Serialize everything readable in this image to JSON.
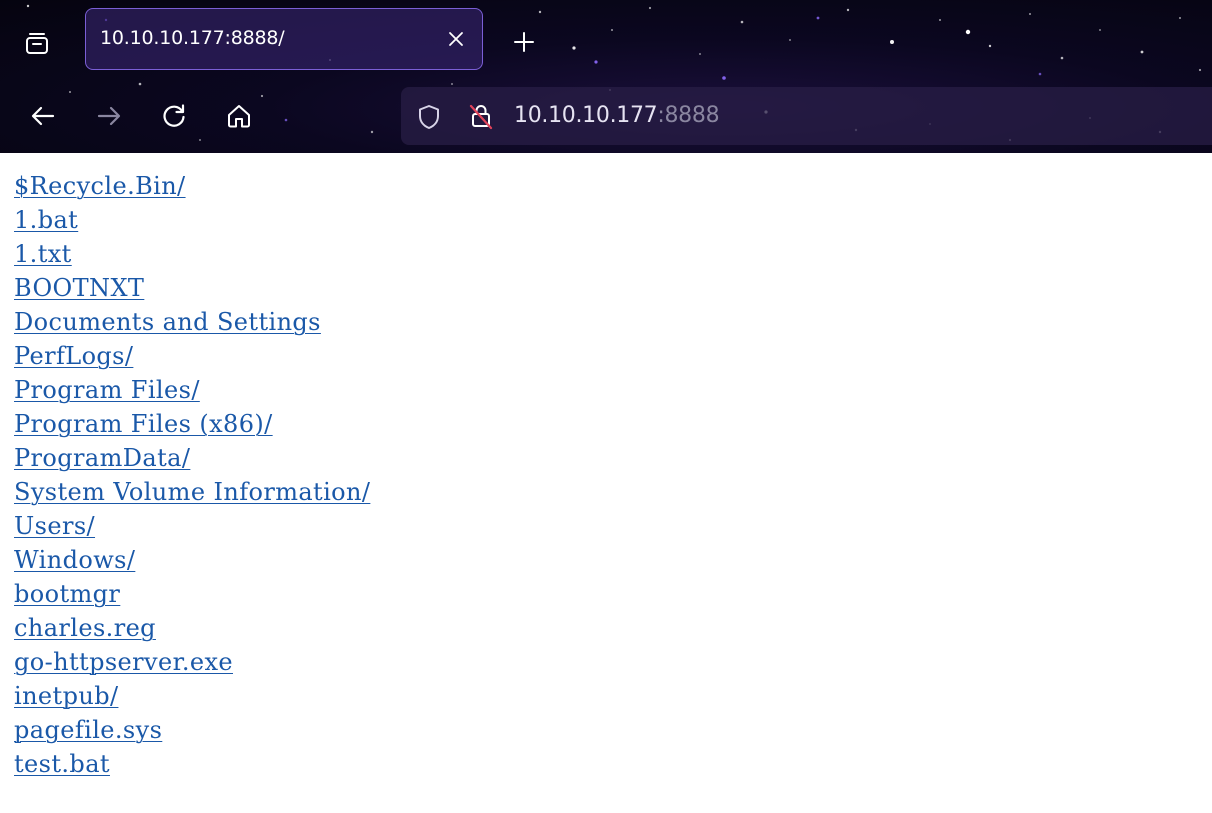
{
  "browser": {
    "tab": {
      "title": "10.10.10.177:8888/"
    },
    "address_bar": {
      "host": "10.10.10.177",
      "port": ":8888"
    },
    "icons": {
      "tab_overview": "tab-overview-icon",
      "close_tab": "close-icon",
      "new_tab": "plus-icon",
      "back": "arrow-left-icon",
      "forward": "arrow-right-icon",
      "reload": "reload-icon",
      "home": "home-icon",
      "tracking_protection": "shield-icon",
      "insecure_connection": "lock-slash-icon"
    },
    "colors": {
      "tab_border": "#7b5fd6",
      "link": "#1a58a8",
      "insecure_lock": "#e0425a"
    }
  },
  "directory": {
    "entries": [
      "$Recycle.Bin/",
      "1.bat",
      "1.txt",
      "BOOTNXT",
      "Documents and Settings",
      "PerfLogs/",
      "Program Files/",
      "Program Files (x86)/",
      "ProgramData/",
      "System Volume Information/",
      "Users/",
      "Windows/",
      "bootmgr",
      "charles.reg",
      "go-httpserver.exe",
      "inetpub/",
      "pagefile.sys",
      "test.bat"
    ]
  }
}
